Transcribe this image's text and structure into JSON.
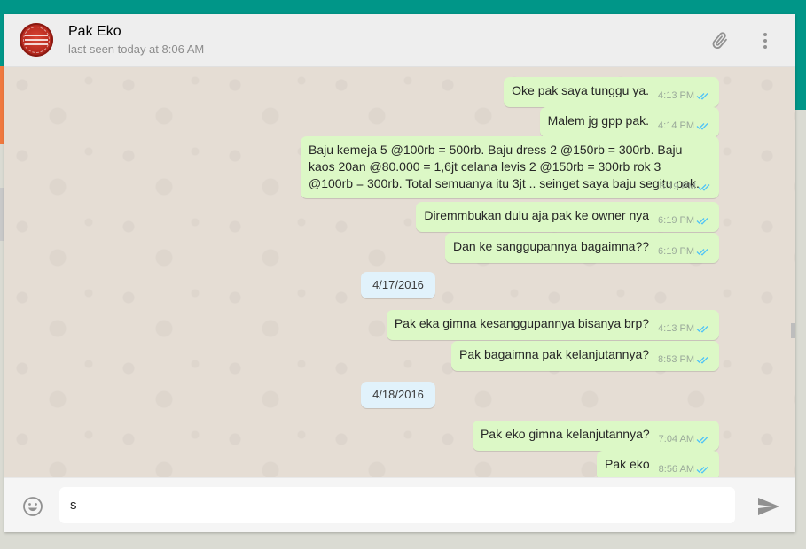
{
  "header": {
    "contact_name": "Pak Eko",
    "last_seen": "last seen today at 8:06 AM",
    "avatar_lines": [
      "Milik",
      "Kaoem",
      "Priboemi"
    ]
  },
  "messages": [
    {
      "text": "Oke pak saya tunggu ya.",
      "time": "4:13 PM",
      "status": "read"
    },
    {
      "text": "Malem jg gpp pak.",
      "time": "4:14 PM",
      "status": "read"
    },
    {
      "text": "Baju kemeja 5 @100rb = 500rb. Baju dress 2 @150rb = 300rb. Baju kaos 20an @80.000 = 1,6jt celana levis 2 @150rb = 300rb rok 3 @100rb = 300rb. Total semuanya itu 3jt .. seinget saya baju segitu pak.",
      "time": "6:19 PM",
      "status": "read"
    },
    {
      "text": "Diremmbukan dulu aja pak ke owner nya",
      "time": "6:19 PM",
      "status": "read"
    },
    {
      "text": "Dan ke sanggupannya bagaimna??",
      "time": "6:19 PM",
      "status": "read"
    },
    {
      "text": "Pak eka gimna kesanggupannya bisanya brp?",
      "time": "4:13 PM",
      "status": "read"
    },
    {
      "text": "Pak bagaimna pak kelanjutannya?",
      "time": "8:53 PM",
      "status": "read"
    },
    {
      "text": "Pak eko gimna kelanjutannya?",
      "time": "7:04 AM",
      "status": "read"
    },
    {
      "text": "Pak eko",
      "time": "8:56 AM",
      "status": "read"
    }
  ],
  "dates": [
    "4/17/2016",
    "4/18/2016"
  ],
  "composer": {
    "value": "s",
    "placeholder": ""
  },
  "icons": {
    "attach": "paperclip-icon",
    "menu": "more-vertical-icon",
    "emoji": "smiley-icon",
    "send": "send-icon",
    "read_tick": "double-check-icon"
  },
  "colors": {
    "header_band": "#009688",
    "outgoing_bubble": "#dcf8c6",
    "date_chip": "#e1f2fb",
    "read_tick": "#4fc3f7"
  }
}
